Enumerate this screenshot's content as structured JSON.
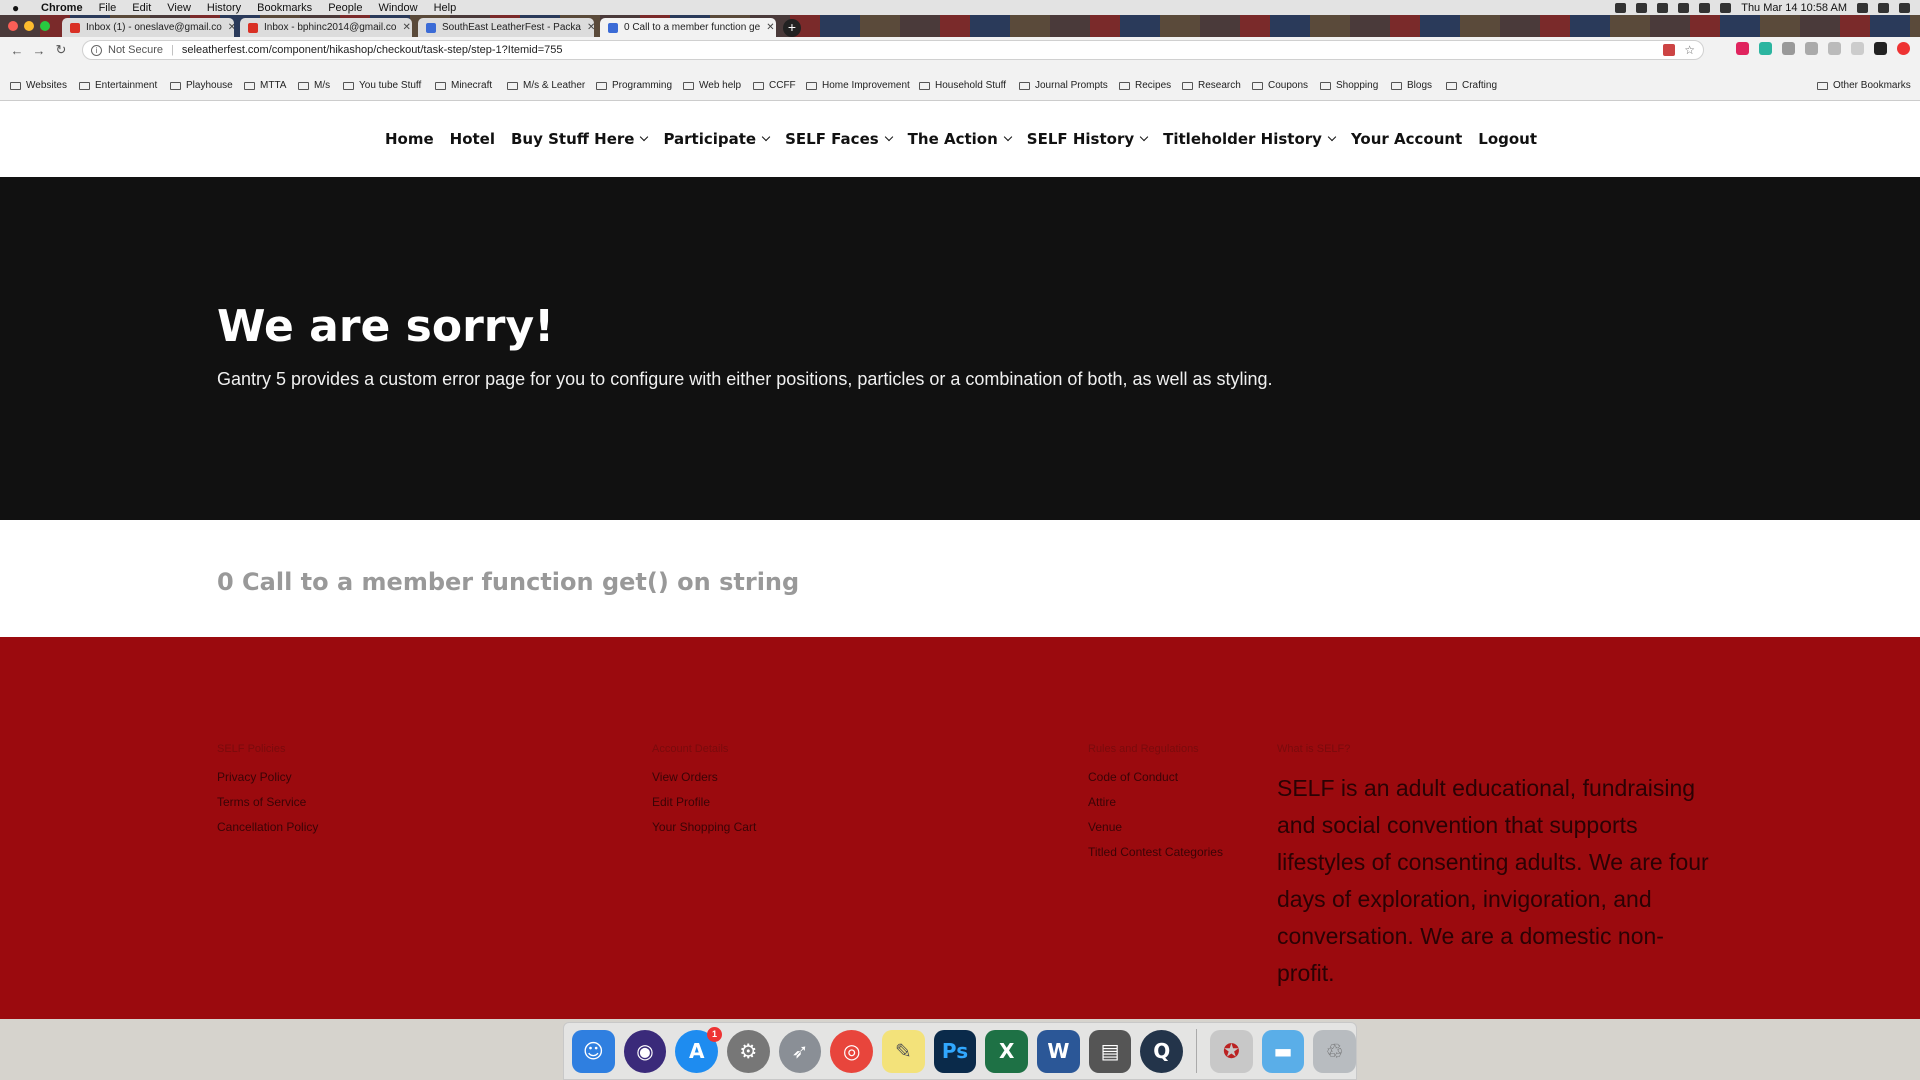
{
  "menubar": {
    "app": "Chrome",
    "items": [
      "File",
      "Edit",
      "View",
      "History",
      "Bookmarks",
      "People",
      "Window",
      "Help"
    ],
    "clock": "Thu Mar 14  10:58 AM"
  },
  "tabs": [
    {
      "title": "Inbox (1) - oneslave@gmail.co",
      "favicon_color": "#d93025"
    },
    {
      "title": "Inbox - bphinc2014@gmail.co",
      "favicon_color": "#d93025"
    },
    {
      "title": "SouthEast LeatherFest - Packa",
      "favicon_color": "#3b6bd6"
    },
    {
      "title": "0 Call to a member function ge",
      "favicon_color": "#3b6bd6"
    }
  ],
  "address": {
    "security": "Not Secure",
    "url": "seleatherfest.com/component/hikashop/checkout/task-step/step-1?Itemid=755"
  },
  "bookmarks": [
    "Websites",
    "Entertainment",
    "Playhouse",
    "MTTA",
    "M/s",
    "You tube Stuff",
    "Minecraft",
    "M/s & Leather",
    "Programming",
    "Web help",
    "CCFF",
    "Home Improvement",
    "Household Stuff",
    "Journal Prompts",
    "Recipes",
    "Research",
    "Coupons",
    "Shopping",
    "Blogs",
    "Crafting"
  ],
  "other_bookmarks": "Other Bookmarks",
  "nav": [
    {
      "label": "Home",
      "dropdown": false
    },
    {
      "label": "Hotel",
      "dropdown": false
    },
    {
      "label": "Buy Stuff Here",
      "dropdown": true
    },
    {
      "label": "Participate",
      "dropdown": true
    },
    {
      "label": "SELF Faces",
      "dropdown": true
    },
    {
      "label": "The Action",
      "dropdown": true
    },
    {
      "label": "SELF History",
      "dropdown": true
    },
    {
      "label": "Titleholder History",
      "dropdown": true
    },
    {
      "label": "Your Account",
      "dropdown": false
    },
    {
      "label": "Logout",
      "dropdown": false
    }
  ],
  "hero": {
    "title": "We are sorry!",
    "text": "Gantry 5 provides a custom error page for you to configure with either positions, particles or a combination of both, as well as styling."
  },
  "error": {
    "message": "0 Call to a member function get() on string"
  },
  "footer": {
    "columns": [
      {
        "heading": "SELF Policies",
        "links": [
          "Privacy Policy",
          "Terms of Service",
          "Cancellation Policy"
        ]
      },
      {
        "heading": "Account Details",
        "links": [
          "View Orders",
          "Edit Profile",
          "Your Shopping Cart"
        ]
      },
      {
        "heading": "Rules and Regulations",
        "links": [
          "Code of Conduct",
          "Attire",
          "Venue",
          "Titled Contest Categories"
        ]
      }
    ],
    "about": {
      "heading": "What is SELF?",
      "text": "SELF is an adult educational, fundraising and social convention that supports lifestyles of consenting adults. We are four days of exploration, invigoration, and conversation. We are a domestic non-profit."
    }
  },
  "dock": [
    {
      "name": "finder-icon",
      "color": "#2f7fe0",
      "glyph": "☺"
    },
    {
      "name": "siri-icon",
      "color": "#3a2a7a",
      "glyph": "◉"
    },
    {
      "name": "app-store-icon",
      "color": "#1e8cf0",
      "glyph": "A",
      "badge": "1"
    },
    {
      "name": "system-preferences-icon",
      "color": "#777777",
      "glyph": "⚙"
    },
    {
      "name": "launchpad-icon",
      "color": "#8a8f96",
      "glyph": "➶"
    },
    {
      "name": "chrome-icon",
      "color": "#e8453c",
      "glyph": "◎"
    },
    {
      "name": "stickies-icon",
      "color": "#f3e27a",
      "glyph": "✎"
    },
    {
      "name": "photoshop-icon",
      "color": "#0a2a4a",
      "glyph": "Ps"
    },
    {
      "name": "excel-icon",
      "color": "#1e7145",
      "glyph": "X"
    },
    {
      "name": "word-icon",
      "color": "#2b5797",
      "glyph": "W"
    },
    {
      "name": "printer-icon",
      "color": "#555555",
      "glyph": "▤"
    },
    {
      "name": "quicktime-icon",
      "color": "#23344a",
      "glyph": "Q"
    },
    {
      "name": "vendors-icon",
      "color": "#c8c8c8",
      "glyph": "✪"
    },
    {
      "name": "folder-icon",
      "color": "#5aaee8",
      "glyph": "▬"
    },
    {
      "name": "trash-icon",
      "color": "#b8bcc0",
      "glyph": "🗑"
    }
  ]
}
